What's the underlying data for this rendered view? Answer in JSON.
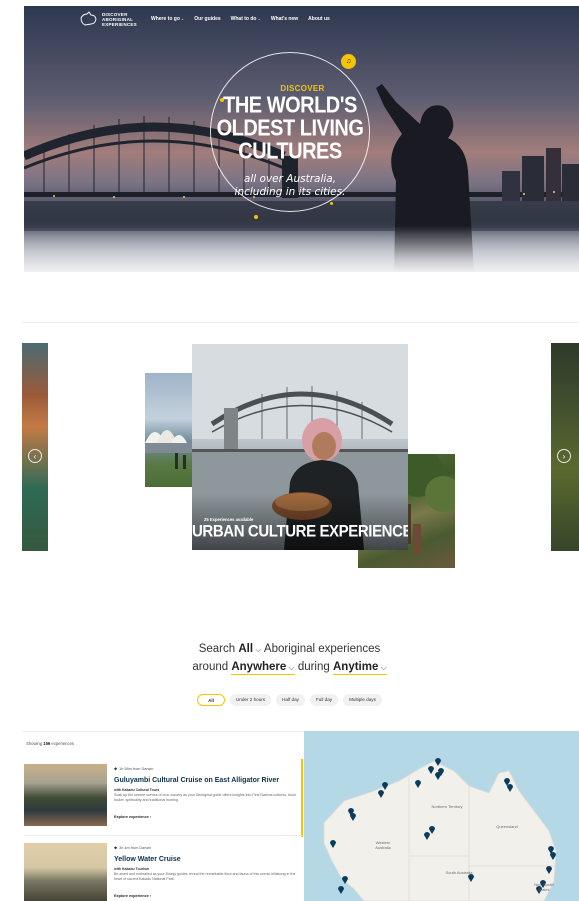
{
  "nav": {
    "logo_text": "DISCOVER ABORIGINAL EXPERIENCES",
    "items": [
      {
        "label": "Where to go",
        "has_dropdown": true
      },
      {
        "label": "Our guides",
        "has_dropdown": false
      },
      {
        "label": "What to do",
        "has_dropdown": true
      },
      {
        "label": "What's new",
        "has_dropdown": false
      },
      {
        "label": "About us",
        "has_dropdown": false
      }
    ]
  },
  "hero": {
    "kicker": "DISCOVER",
    "title": "THE WORLD'S OLDEST LIVING CULTURES",
    "subtitle": "all over Australia, including in its cities."
  },
  "carousel": {
    "card_meta": "25 Experiences available",
    "card_title": "URBAN CULTURE EXPERIENCES"
  },
  "search": {
    "word_search": "Search",
    "category": "All",
    "word_experiences": "Aboriginal experiences",
    "word_around": "around",
    "location": "Anywhere",
    "word_during": "during",
    "time": "Anytime",
    "filters": [
      "All",
      "Under 2 hours",
      "Half day",
      "Full day",
      "Multiple days"
    ],
    "active_filter": "All"
  },
  "results": {
    "showing_prefix": "Showing",
    "count": "156",
    "showing_suffix": "experiences",
    "items": [
      {
        "distance": "1h 58m from Darwin",
        "title": "Guluyambi Cultural Cruise on East Alligator River",
        "operator": "with Kakadu Cultural Tours",
        "description": "Soak up the serene scenes of croc country as your Aboriginal guide offers insights into First Nations cultures, bush tucker, spirituality and traditional hunting.",
        "link": "Explore experience"
      },
      {
        "distance": "3h 4m from Darwin",
        "title": "Yellow Water Cruise",
        "operator": "with Kakadu Tourism",
        "description": "Be awed and enthralled as your Bininjy guides reveal the remarkable flora and fauna of this scenic billabong in the heart of sacred Kakadu National Park.",
        "link": "Explore experience"
      }
    ]
  },
  "map": {
    "labels": [
      "Northern Territory",
      "Queensland",
      "Western Australia",
      "South Australia",
      "New South Wales"
    ],
    "colors": {
      "water": "#b5d8e6",
      "land": "#f2f0ea",
      "pin": "#0b3c5d"
    }
  },
  "colors": {
    "accent": "#f5c400",
    "navy": "#0b2f4a"
  }
}
